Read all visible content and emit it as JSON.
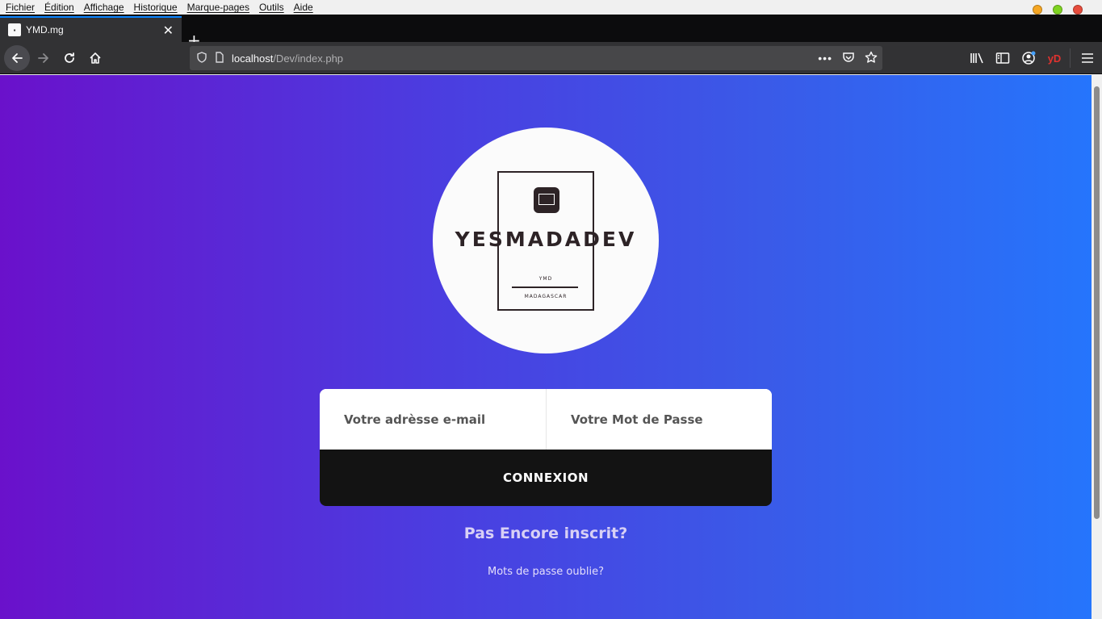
{
  "menu": [
    "Fichier",
    "Édition",
    "Affichage",
    "Historique",
    "Marque-pages",
    "Outils",
    "Aide"
  ],
  "window_controls": {
    "minimize_color": "#f5a623",
    "maximize_color": "#7ed321",
    "close_color": "#e74c3c"
  },
  "tab": {
    "title": "YMD.mg",
    "close": "✕"
  },
  "new_tab": "+",
  "url": {
    "host": "localhost",
    "path": "/Dev/index.php"
  },
  "toolbar": {
    "profile_label": "yD",
    "accent": "#0a84ff"
  },
  "logo": {
    "title": "YESMADADEV",
    "subtitle": "YMD",
    "country": "MADAGASCAR"
  },
  "login": {
    "email_placeholder": "Votre adrèsse e-mail",
    "password_placeholder": "Votre Mot de Passe",
    "submit_label": "CONNEXION"
  },
  "signup_link": "Pas Encore inscrit?",
  "forgot_link": "Mots de passe oublie?",
  "colors": {
    "gradient_start": "#6a11cb",
    "gradient_end": "#2575fc",
    "button": "#131313"
  }
}
